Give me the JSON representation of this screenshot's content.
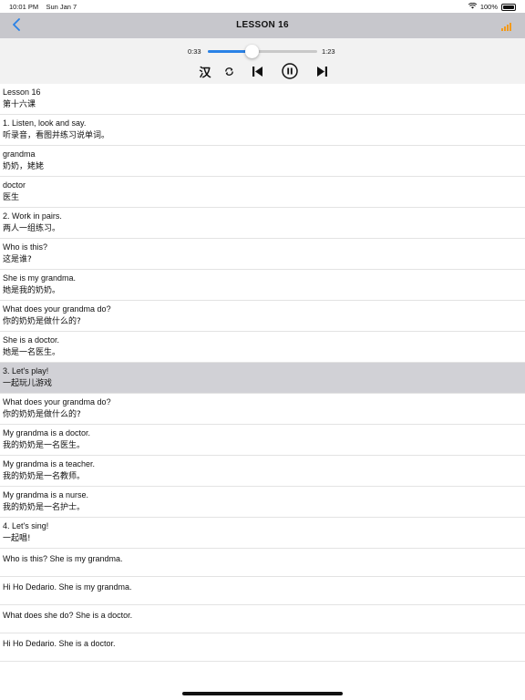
{
  "status_bar": {
    "time": "10:01 PM",
    "date": "Sun Jan 7",
    "battery": "100%"
  },
  "nav": {
    "title": "LESSON 16",
    "back_icon": "chevron-left-icon",
    "menu_icon": "bars-icon",
    "accent": "#2a82e6",
    "bars_color": "#f39a1a"
  },
  "player": {
    "current_time": "0:33",
    "total_time": "1:23",
    "progress": 0.4,
    "han_label": "汉",
    "icons": [
      "repeat-icon",
      "previous-icon",
      "pause-icon",
      "next-icon"
    ]
  },
  "rows": [
    {
      "en": "Lesson 16",
      "zh": "第十六课"
    },
    {
      "en": "1. Listen, look and say.",
      "zh": "听录音，看图并练习说单词。"
    },
    {
      "en": "grandma",
      "zh": "奶奶，姥姥"
    },
    {
      "en": "doctor",
      "zh": "医生"
    },
    {
      "en": "2. Work in pairs.",
      "zh": "两人一组练习。"
    },
    {
      "en": "Who is this?",
      "zh": "这是谁?"
    },
    {
      "en": "She is my grandma.",
      "zh": "她是我的奶奶。"
    },
    {
      "en": "What does your grandma do?",
      "zh": "你的奶奶是做什么的?"
    },
    {
      "en": "She is a doctor.",
      "zh": "她是一名医生。"
    },
    {
      "en": "3. Let's play!",
      "zh": "一起玩儿游戏",
      "highlight": true
    },
    {
      "en": "What does your grandma do?",
      "zh": "你的奶奶是做什么的?"
    },
    {
      "en": "My grandma is a doctor.",
      "zh": "我的奶奶是一名医生。"
    },
    {
      "en": "My grandma is a teacher.",
      "zh": "我的奶奶是一名教师。"
    },
    {
      "en": "My grandma is a nurse.",
      "zh": "我的奶奶是一名护士。"
    },
    {
      "en": "4. Let's sing!",
      "zh": "一起唱!"
    },
    {
      "en": "Who is this? She is my grandma.",
      "zh": ""
    },
    {
      "en": "Hi Ho Dedario. She is my grandma.",
      "zh": ""
    },
    {
      "en": "What does she do? She is a doctor.",
      "zh": ""
    },
    {
      "en": "Hi Ho Dedario. She is a doctor.",
      "zh": ""
    }
  ]
}
